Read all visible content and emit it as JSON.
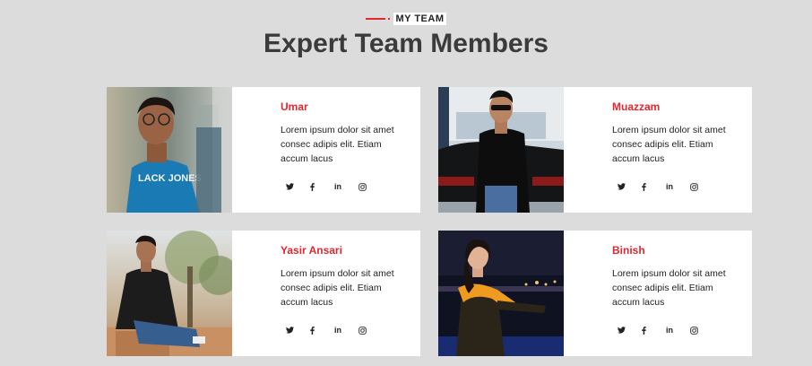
{
  "header": {
    "eyebrow": "MY TEAM",
    "title": "Expert Team Members"
  },
  "accent_color": "#e4262e",
  "members": [
    {
      "name": "Umar",
      "description": "Lorem ipsum dolor sit amet consec adipis elit. Etiam accum lacus",
      "socials": [
        "twitter-icon",
        "facebook-icon",
        "linkedin-icon",
        "instagram-icon"
      ],
      "linkedin_label": "in"
    },
    {
      "name": "Muazzam",
      "description": "Lorem ipsum dolor sit amet consec adipis elit. Etiam accum lacus",
      "socials": [
        "twitter-icon",
        "facebook-icon",
        "linkedin-icon",
        "instagram-icon"
      ],
      "linkedin_label": "in"
    },
    {
      "name": "Yasir Ansari",
      "description": "Lorem ipsum dolor sit amet consec adipis elit. Etiam accum lacus",
      "socials": [
        "twitter-icon",
        "facebook-icon",
        "linkedin-icon",
        "instagram-icon"
      ],
      "linkedin_label": "in"
    },
    {
      "name": "Binish",
      "description": "Lorem ipsum dolor sit amet consec adipis elit. Etiam accum lacus",
      "socials": [
        "twitter-icon",
        "facebook-icon",
        "linkedin-icon",
        "instagram-icon"
      ],
      "linkedin_label": "in"
    }
  ]
}
